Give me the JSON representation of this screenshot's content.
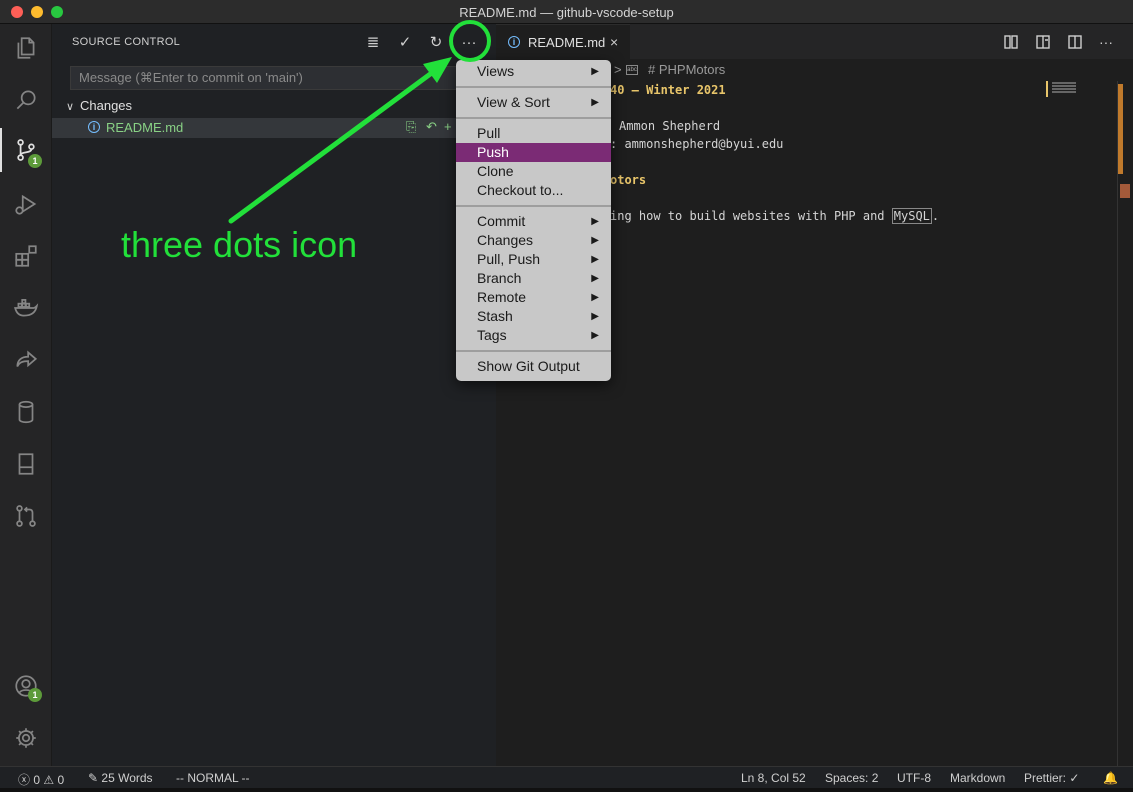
{
  "window": {
    "title": "README.md — github-vscode-setup"
  },
  "activity_bar": {
    "items": [
      {
        "icon": "files-icon"
      },
      {
        "icon": "search-icon"
      },
      {
        "icon": "source-control-icon",
        "badge": "1"
      },
      {
        "icon": "run-debug-icon"
      },
      {
        "icon": "extensions-icon"
      },
      {
        "icon": "docker-icon"
      },
      {
        "icon": "live-share-icon"
      },
      {
        "icon": "database-icon"
      },
      {
        "icon": "remote-explorer-icon"
      },
      {
        "icon": "pull-requests-icon"
      }
    ],
    "account_badge": "1",
    "accent_color": "#5d9b3a"
  },
  "sidebar": {
    "title": "SOURCE CONTROL",
    "message_placeholder": "Message (⌘Enter to commit on 'main')",
    "changes_label": "Changes",
    "file_name": "README.md",
    "file_color": "#89d185"
  },
  "tab": {
    "label": "README.md"
  },
  "breadcrumb": {
    "separator": ">",
    "heading": "# PHPMotors"
  },
  "editor": {
    "lines": {
      "l1": "40 – Winter 2021",
      "l2": "Ammon Shepherd",
      "l3": ": ammonshepherd@byui.edu",
      "l4": "otors",
      "l5a": "ing how to build websites with PHP and ",
      "l5b": "MySQL",
      "l5c": "."
    }
  },
  "context_menu": {
    "items": [
      {
        "label": "Views",
        "submenu": true
      },
      {
        "label": "View & Sort",
        "submenu": true
      },
      {
        "label": "Pull",
        "submenu": false
      },
      {
        "label": "Push",
        "submenu": false,
        "highlighted": true
      },
      {
        "label": "Clone",
        "submenu": false
      },
      {
        "label": "Checkout to...",
        "submenu": false
      },
      {
        "label": "Commit",
        "submenu": true
      },
      {
        "label": "Changes",
        "submenu": true
      },
      {
        "label": "Pull, Push",
        "submenu": true
      },
      {
        "label": "Branch",
        "submenu": true
      },
      {
        "label": "Remote",
        "submenu": true
      },
      {
        "label": "Stash",
        "submenu": true
      },
      {
        "label": "Tags",
        "submenu": true
      },
      {
        "label": "Show Git Output",
        "submenu": false
      }
    ],
    "highlight_color": "#7b2b75"
  },
  "annotation": {
    "text": "three dots icon",
    "color": "#22e03a"
  },
  "status_bar": {
    "errors": "0",
    "warnings": "0",
    "words": "25 Words",
    "mode": "-- NORMAL --",
    "position": "Ln 8, Col 52",
    "spaces": "Spaces: 2",
    "encoding": "UTF-8",
    "language": "Markdown",
    "prettier": "Prettier: ✓"
  }
}
